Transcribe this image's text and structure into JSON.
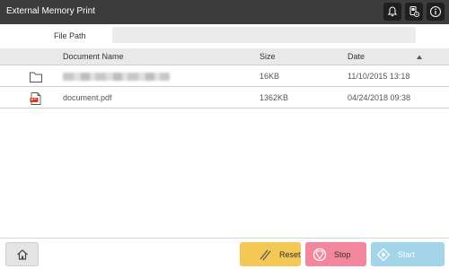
{
  "window": {
    "title": "External Memory Print",
    "icons": [
      "bell-icon",
      "device-status-icon",
      "info-icon"
    ]
  },
  "path": {
    "label": "File Path",
    "value": ""
  },
  "table": {
    "columns": {
      "name": "Document Name",
      "size": "Size",
      "date": "Date"
    },
    "sort_indicator": "ascending",
    "rows": [
      {
        "type": "folder-icon",
        "name": "",
        "size": "16KB",
        "date": "11/10/2015 13:18"
      },
      {
        "type": "pdf-file-icon",
        "name": "document.pdf",
        "size": "1362KB",
        "date": "04/24/2018 09:38"
      }
    ]
  },
  "footer": {
    "reset_label": "Reset",
    "stop_label": "Stop",
    "start_label": "Start"
  },
  "colors": {
    "titlebar": "#3c3c3c",
    "reset": "#f3c857",
    "stop": "#f2879e",
    "start": "#a3d5ea",
    "pdf_red": "#d9361d"
  }
}
